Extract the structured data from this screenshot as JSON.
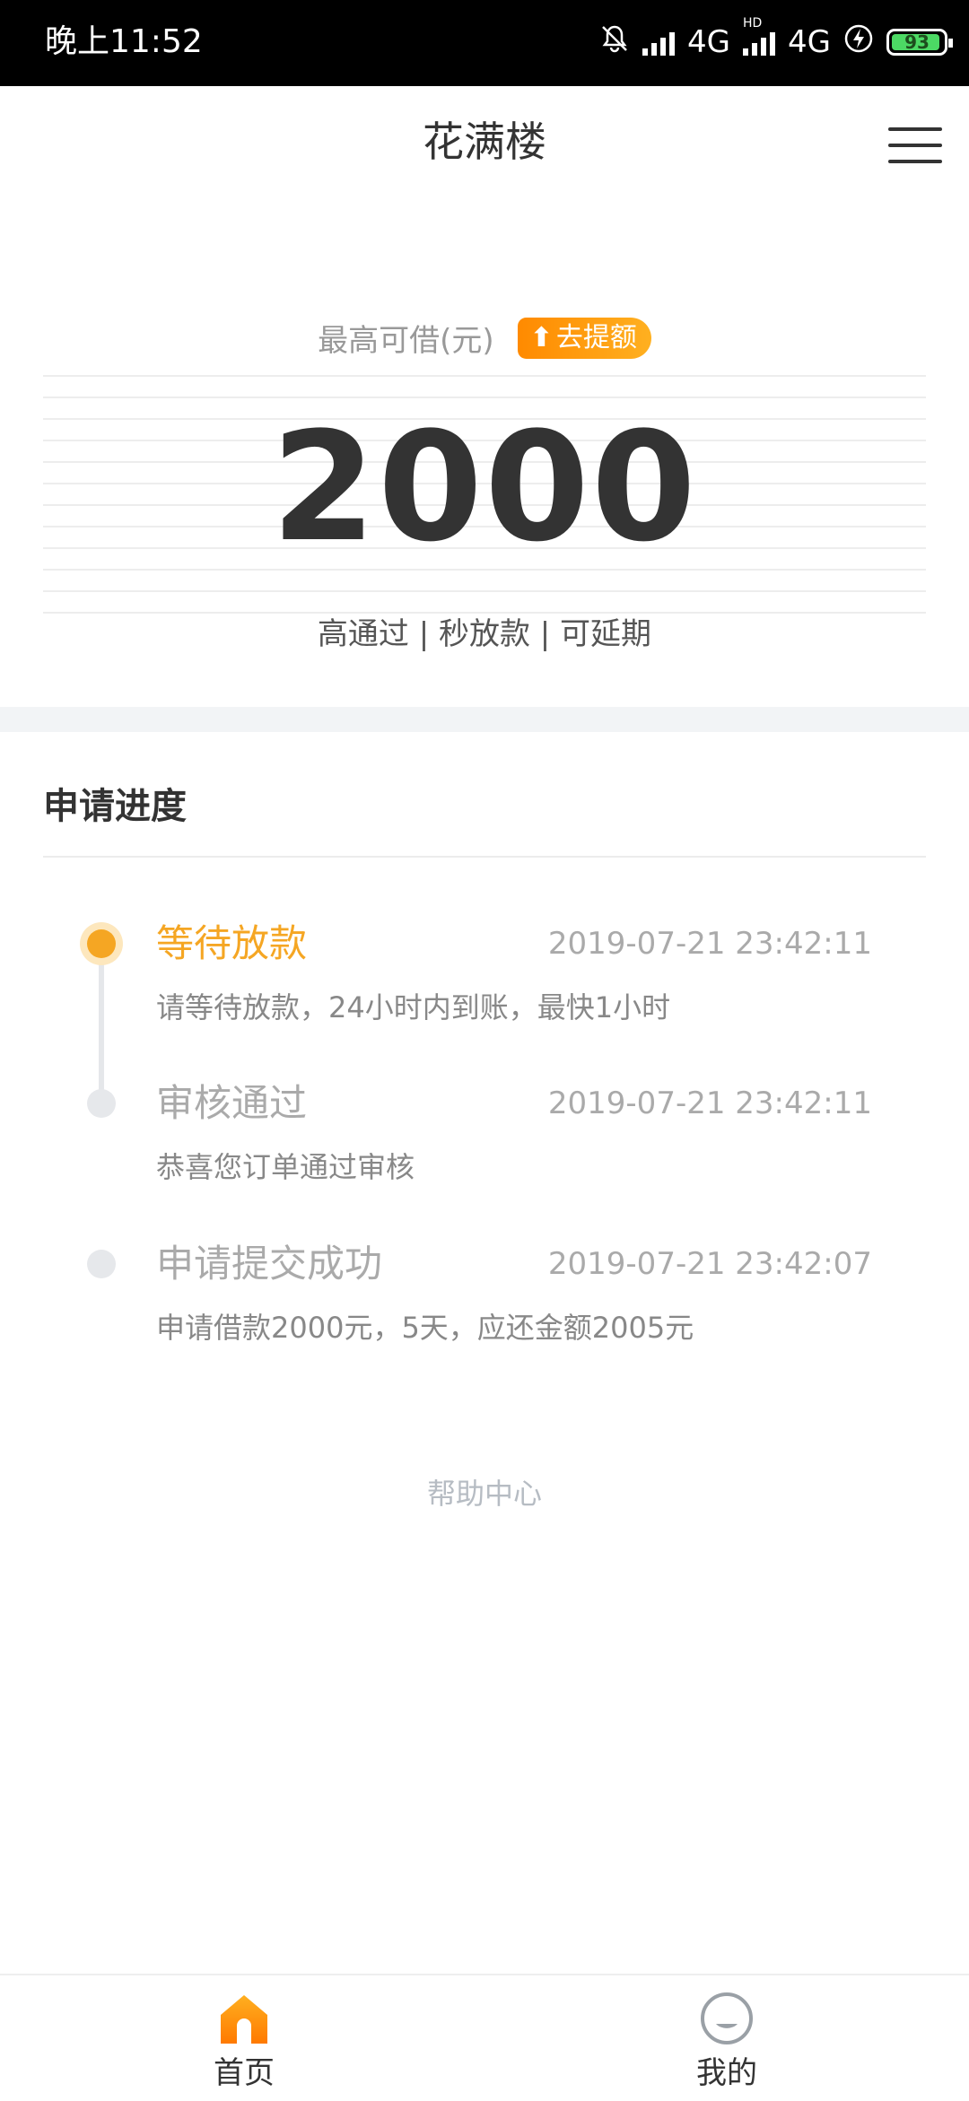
{
  "status_bar": {
    "time": "晚上11:52",
    "network1": "4G",
    "network2": "4G",
    "hd": "HD",
    "battery": "93"
  },
  "header": {
    "title": "花满楼"
  },
  "hero": {
    "label": "最高可借(元)",
    "raise_button": "去提额",
    "amount": "2000",
    "tags": "高通过 | 秒放款 | 可延期"
  },
  "progress": {
    "title": "申请进度",
    "steps": [
      {
        "title": "等待放款",
        "time": "2019-07-21 23:42:11",
        "desc": "请等待放款，24小时内到账，最快1小时",
        "active": true
      },
      {
        "title": "审核通过",
        "time": "2019-07-21 23:42:11",
        "desc": "恭喜您订单通过审核",
        "active": false
      },
      {
        "title": "申请提交成功",
        "time": "2019-07-21 23:42:07",
        "desc": "申请借款2000元，5天，应还金额2005元",
        "active": false
      }
    ]
  },
  "help": {
    "label": "帮助中心"
  },
  "tabbar": {
    "home": "首页",
    "mine": "我的"
  },
  "colors": {
    "accent": "#f5a623",
    "raise_button": "#ff8a00",
    "band": "#f2f4f6"
  }
}
